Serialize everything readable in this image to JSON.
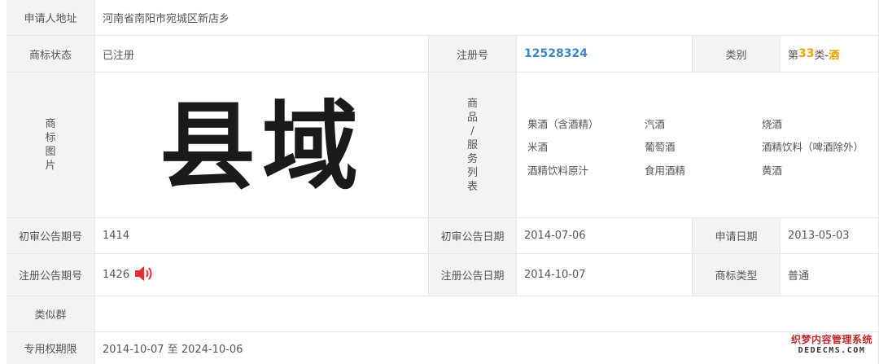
{
  "rows": {
    "address": {
      "label": "申请人地址",
      "value": "河南省南阳市宛城区新店乡"
    },
    "status": {
      "label": "商标状态",
      "value": "已注册",
      "reg_label": "注册号",
      "reg_value": "12528324",
      "cat_label": "类别",
      "cat_prefix": "第",
      "cat_num": "33",
      "cat_mid": "类-",
      "cat_name": "酒"
    },
    "mark": {
      "label_chars": [
        "商",
        "标",
        "图",
        "片"
      ],
      "mark_text": "县域",
      "goods_label_chars": [
        "商",
        "品",
        "/",
        "服",
        "务",
        "列",
        "表"
      ],
      "goods": [
        "果酒（含酒精）",
        "汽酒",
        "烧酒",
        "米酒",
        "葡萄酒",
        "酒精饮料（啤酒除外）",
        "酒精饮料原汁",
        "食用酒精",
        "黄酒"
      ]
    },
    "prelim": {
      "label": "初审公告期号",
      "value": "1414",
      "date_label": "初审公告日期",
      "date_value": "2014-07-06",
      "apply_label": "申请日期",
      "apply_value": "2013-05-03"
    },
    "reg_notice": {
      "label": "注册公告期号",
      "value": "1426",
      "date_label": "注册公告日期",
      "date_value": "2014-10-07",
      "type_label": "商标类型",
      "type_value": "普通",
      "icon": "speaker-icon"
    },
    "similar": {
      "label": "类似群",
      "value": ""
    },
    "exclusive": {
      "label": "专用权期限",
      "value": "2014-10-07 至 2024-10-06"
    }
  },
  "watermark": {
    "line1": "织梦内容管理系统",
    "line2": "DEDECMS.COM"
  },
  "colors": {
    "reg_no": "#3a87c8",
    "category": "#f0a000",
    "speaker": "#e0303a",
    "label_bg": "#f3f3f3",
    "border": "#e6e6e6"
  }
}
